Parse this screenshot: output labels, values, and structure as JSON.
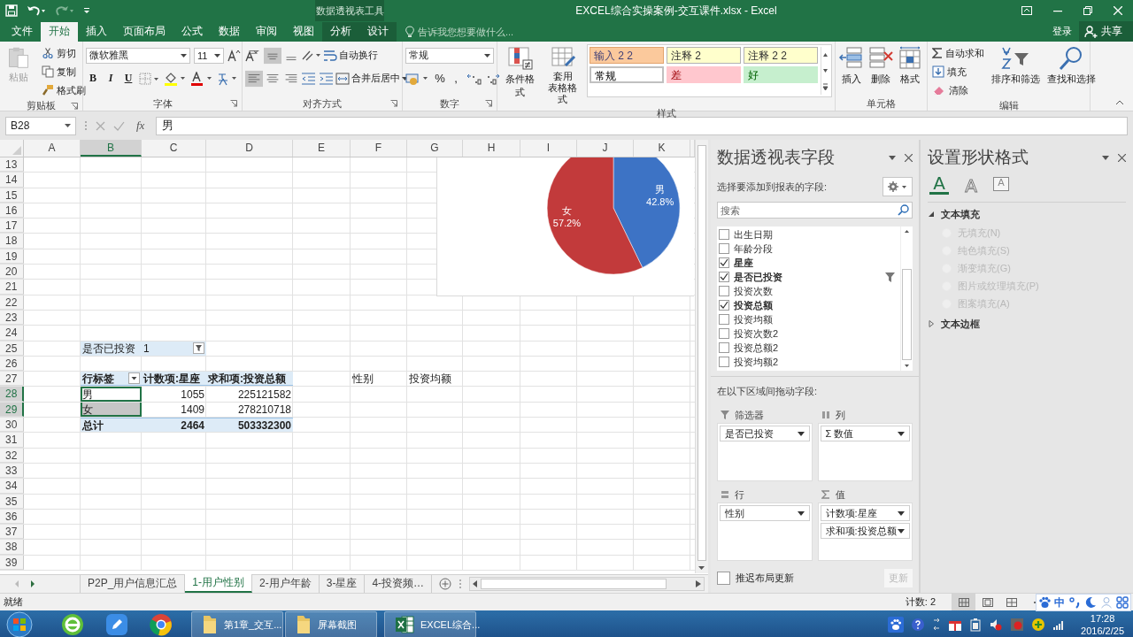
{
  "window": {
    "title": "EXCEL综合实操案例-交互课件.xlsx - Excel",
    "context_label": "数据透视表工具"
  },
  "tabs": [
    {
      "label": "文件",
      "selected": false,
      "contextual": false
    },
    {
      "label": "开始",
      "selected": true,
      "contextual": false
    },
    {
      "label": "插入",
      "selected": false,
      "contextual": false
    },
    {
      "label": "页面布局",
      "selected": false,
      "contextual": false
    },
    {
      "label": "公式",
      "selected": false,
      "contextual": false
    },
    {
      "label": "数据",
      "selected": false,
      "contextual": false
    },
    {
      "label": "审阅",
      "selected": false,
      "contextual": false
    },
    {
      "label": "视图",
      "selected": false,
      "contextual": false
    },
    {
      "label": "分析",
      "selected": false,
      "contextual": true
    },
    {
      "label": "设计",
      "selected": false,
      "contextual": true
    }
  ],
  "tell_me": {
    "placeholder": "告诉我您想要做什么..."
  },
  "account": {
    "sign_in": "登录",
    "share": "共享"
  },
  "ribbon": {
    "groups": [
      {
        "kind": "clipboard",
        "label": "剪贴板",
        "launcher": true,
        "paste": {
          "label": "粘贴",
          "disabled": true
        },
        "commands": [
          "剪切",
          "复制",
          "格式刷"
        ]
      },
      {
        "kind": "font",
        "label": "字体",
        "launcher": true,
        "font_name": "微软雅黑",
        "font_size": "11",
        "format_buttons": [
          "B",
          "I",
          "U"
        ]
      },
      {
        "kind": "alignment",
        "label": "对齐方式",
        "launcher": true,
        "valign": [
          {
            "selected": false
          },
          {
            "selected": true
          },
          {
            "selected": false
          }
        ],
        "halign": [
          {
            "selected": true
          },
          {
            "selected": false
          },
          {
            "selected": false
          }
        ],
        "wrap": "自动换行",
        "merge": "合并后居中"
      },
      {
        "kind": "number",
        "label": "数字",
        "launcher": true,
        "format": "常规",
        "symbols": [
          "%",
          ","
        ]
      },
      {
        "kind": "styles",
        "label": "样式",
        "launcher": false,
        "conditional": "条件格式",
        "table": [
          "套用",
          "表格格式"
        ],
        "gallery": [
          {
            "label": "输入 2 2",
            "kind": "input"
          },
          {
            "label": "注释 2",
            "kind": "note"
          },
          {
            "label": "注释 2 2",
            "kind": "note"
          },
          {
            "label": "常规",
            "kind": "normal"
          },
          {
            "label": "差",
            "kind": "bad"
          },
          {
            "label": "好",
            "kind": "good"
          }
        ]
      },
      {
        "kind": "cells",
        "label": "单元格",
        "launcher": false,
        "commands": [
          "插入",
          "删除",
          "格式"
        ]
      },
      {
        "kind": "editing",
        "label": "编辑",
        "launcher": false,
        "small": [
          "自动求和",
          "填充",
          "清除"
        ],
        "large": [
          "排序和筛选",
          "查找和选择"
        ]
      }
    ]
  },
  "formula_bar": {
    "name_box": "B28",
    "fx": "fx",
    "value": "男"
  },
  "sheet": {
    "columns": [
      {
        "label": "A",
        "selected": false
      },
      {
        "label": "B",
        "selected": true
      },
      {
        "label": "C",
        "selected": false
      },
      {
        "label": "D",
        "selected": false
      },
      {
        "label": "E",
        "selected": false
      },
      {
        "label": "F",
        "selected": false
      },
      {
        "label": "G",
        "selected": false
      },
      {
        "label": "H",
        "selected": false
      },
      {
        "label": "I",
        "selected": false
      },
      {
        "label": "J",
        "selected": false
      },
      {
        "label": "K",
        "selected": false
      }
    ],
    "rows": [
      {
        "number": "13",
        "selected": false
      },
      {
        "number": "14",
        "selected": false
      },
      {
        "number": "15",
        "selected": false
      },
      {
        "number": "16",
        "selected": false
      },
      {
        "number": "17",
        "selected": false
      },
      {
        "number": "18",
        "selected": false
      },
      {
        "number": "19",
        "selected": false
      },
      {
        "number": "20",
        "selected": false
      },
      {
        "number": "21",
        "selected": false
      },
      {
        "number": "22",
        "selected": false
      },
      {
        "number": "23",
        "selected": false
      },
      {
        "number": "24",
        "selected": false
      },
      {
        "number": "25",
        "selected": false,
        "cells": [
          null,
          {
            "text": "是否已投资",
            "kind": "field",
            "selected": false,
            "active": false
          },
          {
            "text": "1",
            "kind": "field_value",
            "selected": false,
            "active": false
          }
        ]
      },
      {
        "number": "26",
        "selected": false
      },
      {
        "number": "27",
        "selected": false,
        "cells": [
          null,
          {
            "text": "行标签",
            "kind": "row_labels_header",
            "selected": false,
            "active": false
          },
          {
            "text": "计数项:星座",
            "kind": "header",
            "selected": false,
            "active": false
          },
          {
            "text": "求和项:投资总额",
            "kind": "header",
            "selected": false,
            "active": false
          },
          null,
          {
            "text": "性别",
            "kind": "plain",
            "selected": false,
            "active": false
          },
          {
            "text": "投资均额",
            "kind": "plain",
            "selected": false,
            "active": false
          }
        ]
      },
      {
        "number": "28",
        "selected": true,
        "cells": [
          null,
          {
            "text": "男",
            "kind": "item",
            "selected": true,
            "active": true
          },
          {
            "text": "1055",
            "kind": "value",
            "selected": false,
            "active": false
          },
          {
            "text": "225121582",
            "kind": "value",
            "selected": false,
            "active": false
          }
        ]
      },
      {
        "number": "29",
        "selected": true,
        "cells": [
          null,
          {
            "text": "女",
            "kind": "item",
            "selected": true,
            "active": false
          },
          {
            "text": "1409",
            "kind": "value",
            "selected": false,
            "active": false
          },
          {
            "text": "278210718",
            "kind": "value",
            "selected": false,
            "active": false
          }
        ]
      },
      {
        "number": "30",
        "selected": false,
        "cells": [
          null,
          {
            "text": "总计",
            "kind": "total",
            "selected": false,
            "active": false
          },
          {
            "text": "2464",
            "kind": "total_value",
            "selected": false,
            "active": false
          },
          {
            "text": "503332300",
            "kind": "total_value",
            "selected": false,
            "active": false
          }
        ]
      },
      {
        "number": "31",
        "selected": false
      },
      {
        "number": "32",
        "selected": false
      },
      {
        "number": "33",
        "selected": false
      },
      {
        "number": "34",
        "selected": false
      },
      {
        "number": "35",
        "selected": false
      },
      {
        "number": "36",
        "selected": false
      },
      {
        "number": "37",
        "selected": false
      },
      {
        "number": "38",
        "selected": false
      },
      {
        "number": "39",
        "selected": false
      }
    ],
    "chart": {
      "chart_data": {
        "type": "pie",
        "categories": [
          "男",
          "女"
        ],
        "values": [
          42.8,
          57.2
        ],
        "value_labels": [
          "42.8%",
          "57.2%"
        ],
        "data_labels": true
      }
    }
  },
  "sheet_tabs": [
    {
      "label": "P2P_用户信息汇总",
      "selected": false
    },
    {
      "label": "1-用户性别",
      "selected": true
    },
    {
      "label": "2-用户年龄",
      "selected": false
    },
    {
      "label": "3-星座",
      "selected": false
    },
    {
      "label": "4-投资频…",
      "selected": false
    }
  ],
  "pivot_fields": {
    "title": "数据透视表字段",
    "prompt": "选择要添加到报表的字段:",
    "search": {
      "placeholder": "搜索"
    },
    "fields": [
      {
        "label": "出生日期",
        "checked": false,
        "filtered": false
      },
      {
        "label": "年龄分段",
        "checked": false,
        "filtered": false
      },
      {
        "label": "星座",
        "checked": true,
        "filtered": false
      },
      {
        "label": "是否已投资",
        "checked": true,
        "filtered": true
      },
      {
        "label": "投资次数",
        "checked": false,
        "filtered": false
      },
      {
        "label": "投资总额",
        "checked": true,
        "filtered": false
      },
      {
        "label": "投资均额",
        "checked": false,
        "filtered": false
      },
      {
        "label": "投资次数2",
        "checked": false,
        "filtered": false
      },
      {
        "label": "投资总额2",
        "checked": false,
        "filtered": false
      },
      {
        "label": "投资均额2",
        "checked": false,
        "filtered": false
      }
    ],
    "areas_prompt": "在以下区域间拖动字段:",
    "areas": [
      {
        "kind": "filters",
        "title": "筛选器",
        "items": [
          "是否已投资"
        ]
      },
      {
        "kind": "columns",
        "title": "列",
        "items": [
          "Σ 数值"
        ]
      },
      {
        "kind": "rows",
        "title": "行",
        "items": [
          "性别"
        ]
      },
      {
        "kind": "values",
        "title": "值",
        "items": [
          "计数项:星座",
          "求和项:投资总额"
        ]
      }
    ],
    "defer": {
      "label": "推迟布局更新",
      "checked": false
    },
    "update": {
      "label": "更新",
      "disabled": true
    }
  },
  "format_shape": {
    "title": "设置形状格式",
    "tabs": [
      {
        "glyph": "A",
        "kind": "fill",
        "selected": true
      },
      {
        "glyph": "A",
        "kind": "outline",
        "selected": false
      },
      {
        "glyph": "A",
        "kind": "textbox",
        "selected": false
      }
    ],
    "sections": [
      {
        "label": "文本填充",
        "expanded": true,
        "options": [
          {
            "label": "无填充(N)",
            "disabled": true
          },
          {
            "label": "纯色填充(S)",
            "disabled": true
          },
          {
            "label": "渐变填充(G)",
            "disabled": true
          },
          {
            "label": "图片或纹理填充(P)",
            "disabled": true
          },
          {
            "label": "图案填充(A)",
            "disabled": true
          }
        ]
      },
      {
        "label": "文本边框",
        "expanded": false
      }
    ]
  },
  "status_bar": {
    "status": "就绪",
    "count": "计数: 2",
    "views": [
      {
        "selected": true
      },
      {
        "selected": false
      },
      {
        "selected": false
      }
    ]
  },
  "ime_bar": {
    "mode": "中"
  },
  "taskbar": {
    "windows": [
      {
        "label": "第1章_交互...",
        "kind": "folder"
      },
      {
        "label": "屏幕截图",
        "kind": "folder"
      },
      {
        "label": "EXCEL综合...",
        "kind": "excel"
      }
    ],
    "time": "17:28",
    "date": "2016/2/25"
  }
}
